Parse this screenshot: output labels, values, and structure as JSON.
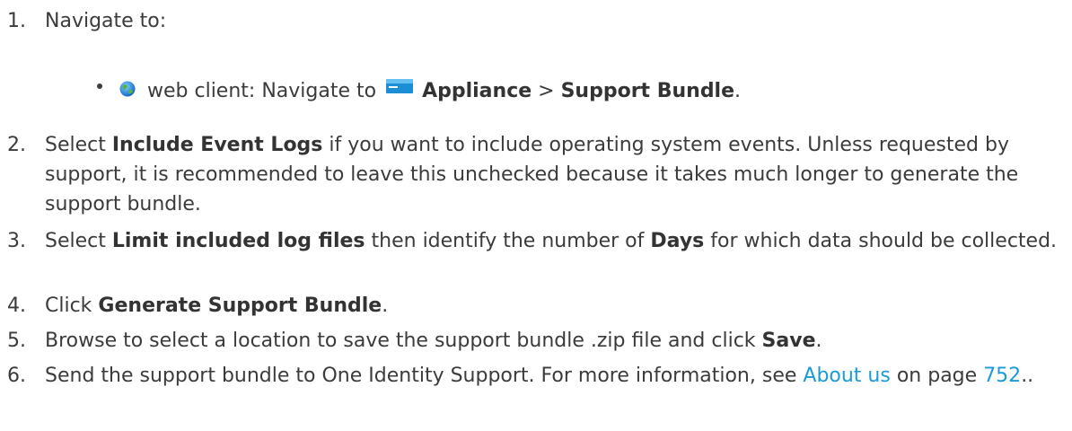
{
  "steps": [
    {
      "num": "1.",
      "text": "Navigate to:",
      "sub": {
        "client_label": "web client: Navigate to ",
        "appliance": "Appliance",
        "sep": " > ",
        "bundle": "Support Bundle",
        "end": "."
      }
    },
    {
      "num": "2.",
      "pre": "Select ",
      "bold": "Include Event Logs",
      "post": " if you want to include operating system events. Unless requested by support, it is recommended to leave this unchecked because it takes much longer to generate the support bundle."
    },
    {
      "num": "3.",
      "pre": "Select ",
      "bold1": "Limit included log files",
      "mid": " then identify the number of ",
      "bold2": "Days",
      "post": " for which data should be collected."
    },
    {
      "num": "4.",
      "pre": "Click ",
      "bold": "Generate Support Bundle",
      "post": "."
    },
    {
      "num": "5.",
      "pre": "Browse to select a location to save the support bundle .zip file and click ",
      "bold": "Save",
      "post": "."
    },
    {
      "num": "6.",
      "pre": "Send the support bundle to One Identity Support. For more information, see ",
      "link": "About us",
      "mid": " on page ",
      "page": "752",
      "post": ".."
    }
  ],
  "colors": {
    "text": "#3b3b3b",
    "link": "#1a9bd7"
  },
  "icons": {
    "client": "globe-icon",
    "appliance": "appliance-icon"
  }
}
